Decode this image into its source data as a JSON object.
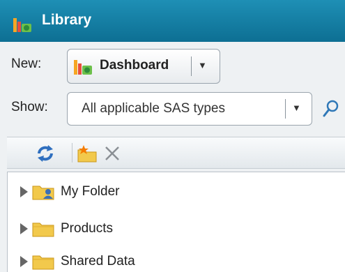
{
  "window": {
    "title": "Library"
  },
  "new_row": {
    "label": "New:",
    "button_label": "Dashboard",
    "button_icon": "dashboard-icon"
  },
  "show_row": {
    "label": "Show:",
    "selected": "All applicable SAS types"
  },
  "toolbar": {
    "buttons": [
      "refresh-icon",
      "new-folder-icon",
      "delete-icon"
    ]
  },
  "tree": {
    "items": [
      {
        "label": "My Folder",
        "icon": "user-folder-icon"
      },
      {
        "label": "Products",
        "icon": "folder-icon"
      },
      {
        "label": "Shared Data",
        "icon": "folder-icon"
      }
    ]
  },
  "colors": {
    "titlebar": "#0d6f93",
    "panel": "#eef1f3",
    "folder": "#f2c94c"
  }
}
